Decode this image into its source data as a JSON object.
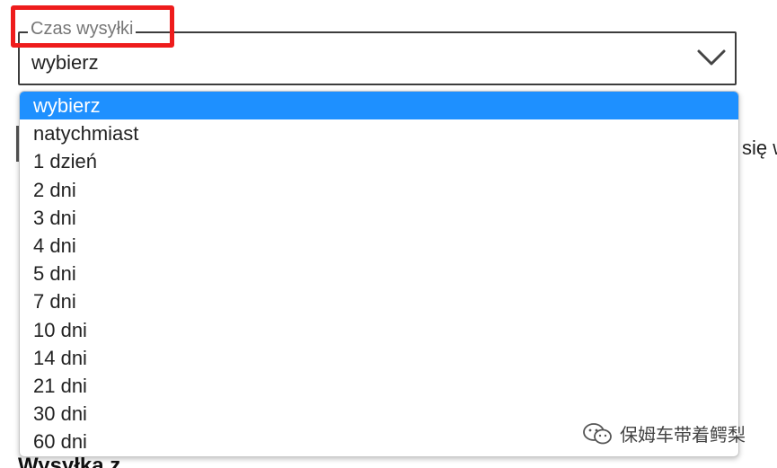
{
  "background": {
    "right_text": "się w",
    "bottom_heading": "Wysyłka z"
  },
  "field": {
    "legend": "Czas wysyłki",
    "value": "wybierz",
    "highlight_color": "#ee1c1c"
  },
  "dropdown": {
    "options": [
      "wybierz",
      "natychmiast",
      "1 dzień",
      "2 dni",
      "3 dni",
      "4 dni",
      "5 dni",
      "7 dni",
      "10 dni",
      "14 dni",
      "21 dni",
      "30 dni",
      "60 dni"
    ],
    "selected_index": 0,
    "selected_color": "#1e90ff"
  },
  "watermark": {
    "icon": "wechat-icon",
    "text": "保姆车带着鳄梨"
  }
}
